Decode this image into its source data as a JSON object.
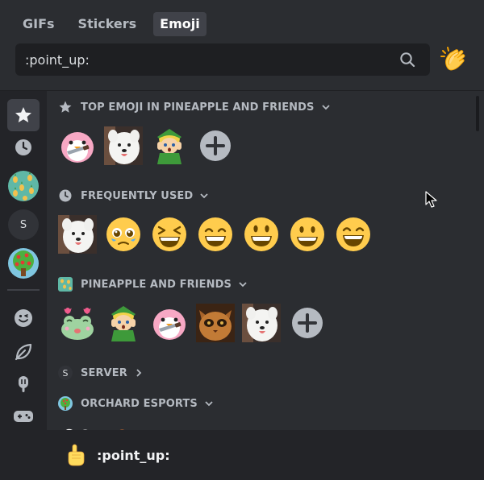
{
  "tabs": [
    {
      "label": "GIFs"
    },
    {
      "label": "Stickers"
    },
    {
      "label": "Emoji"
    }
  ],
  "active_tab": "Emoji",
  "search": {
    "value": ":point_up:",
    "placeholder": ""
  },
  "sections": [
    {
      "label": "TOP EMOJI IN PINEAPPLE AND FRIENDS",
      "icon": "star-icon"
    },
    {
      "label": "FREQUENTLY USED",
      "icon": "clock-icon"
    },
    {
      "label": "PINEAPPLE AND FRIENDS",
      "icon": "server-pineapple-icon"
    },
    {
      "label": "SERVER",
      "icon": "server-letter-icon",
      "letter": "S"
    },
    {
      "label": "ORCHARD ESPORTS",
      "icon": "server-orchard-icon"
    }
  ],
  "rail": {
    "server_letter": "S"
  },
  "footer": {
    "emoji_name": ":point_up:",
    "emoji_icon": "point-up-icon"
  },
  "colors": {
    "background": "#2b2d31",
    "rail": "#232428",
    "search_bg": "#1e1f22",
    "emoji_yellow": "#ffcc4d",
    "add_button": "#b5bac1"
  }
}
